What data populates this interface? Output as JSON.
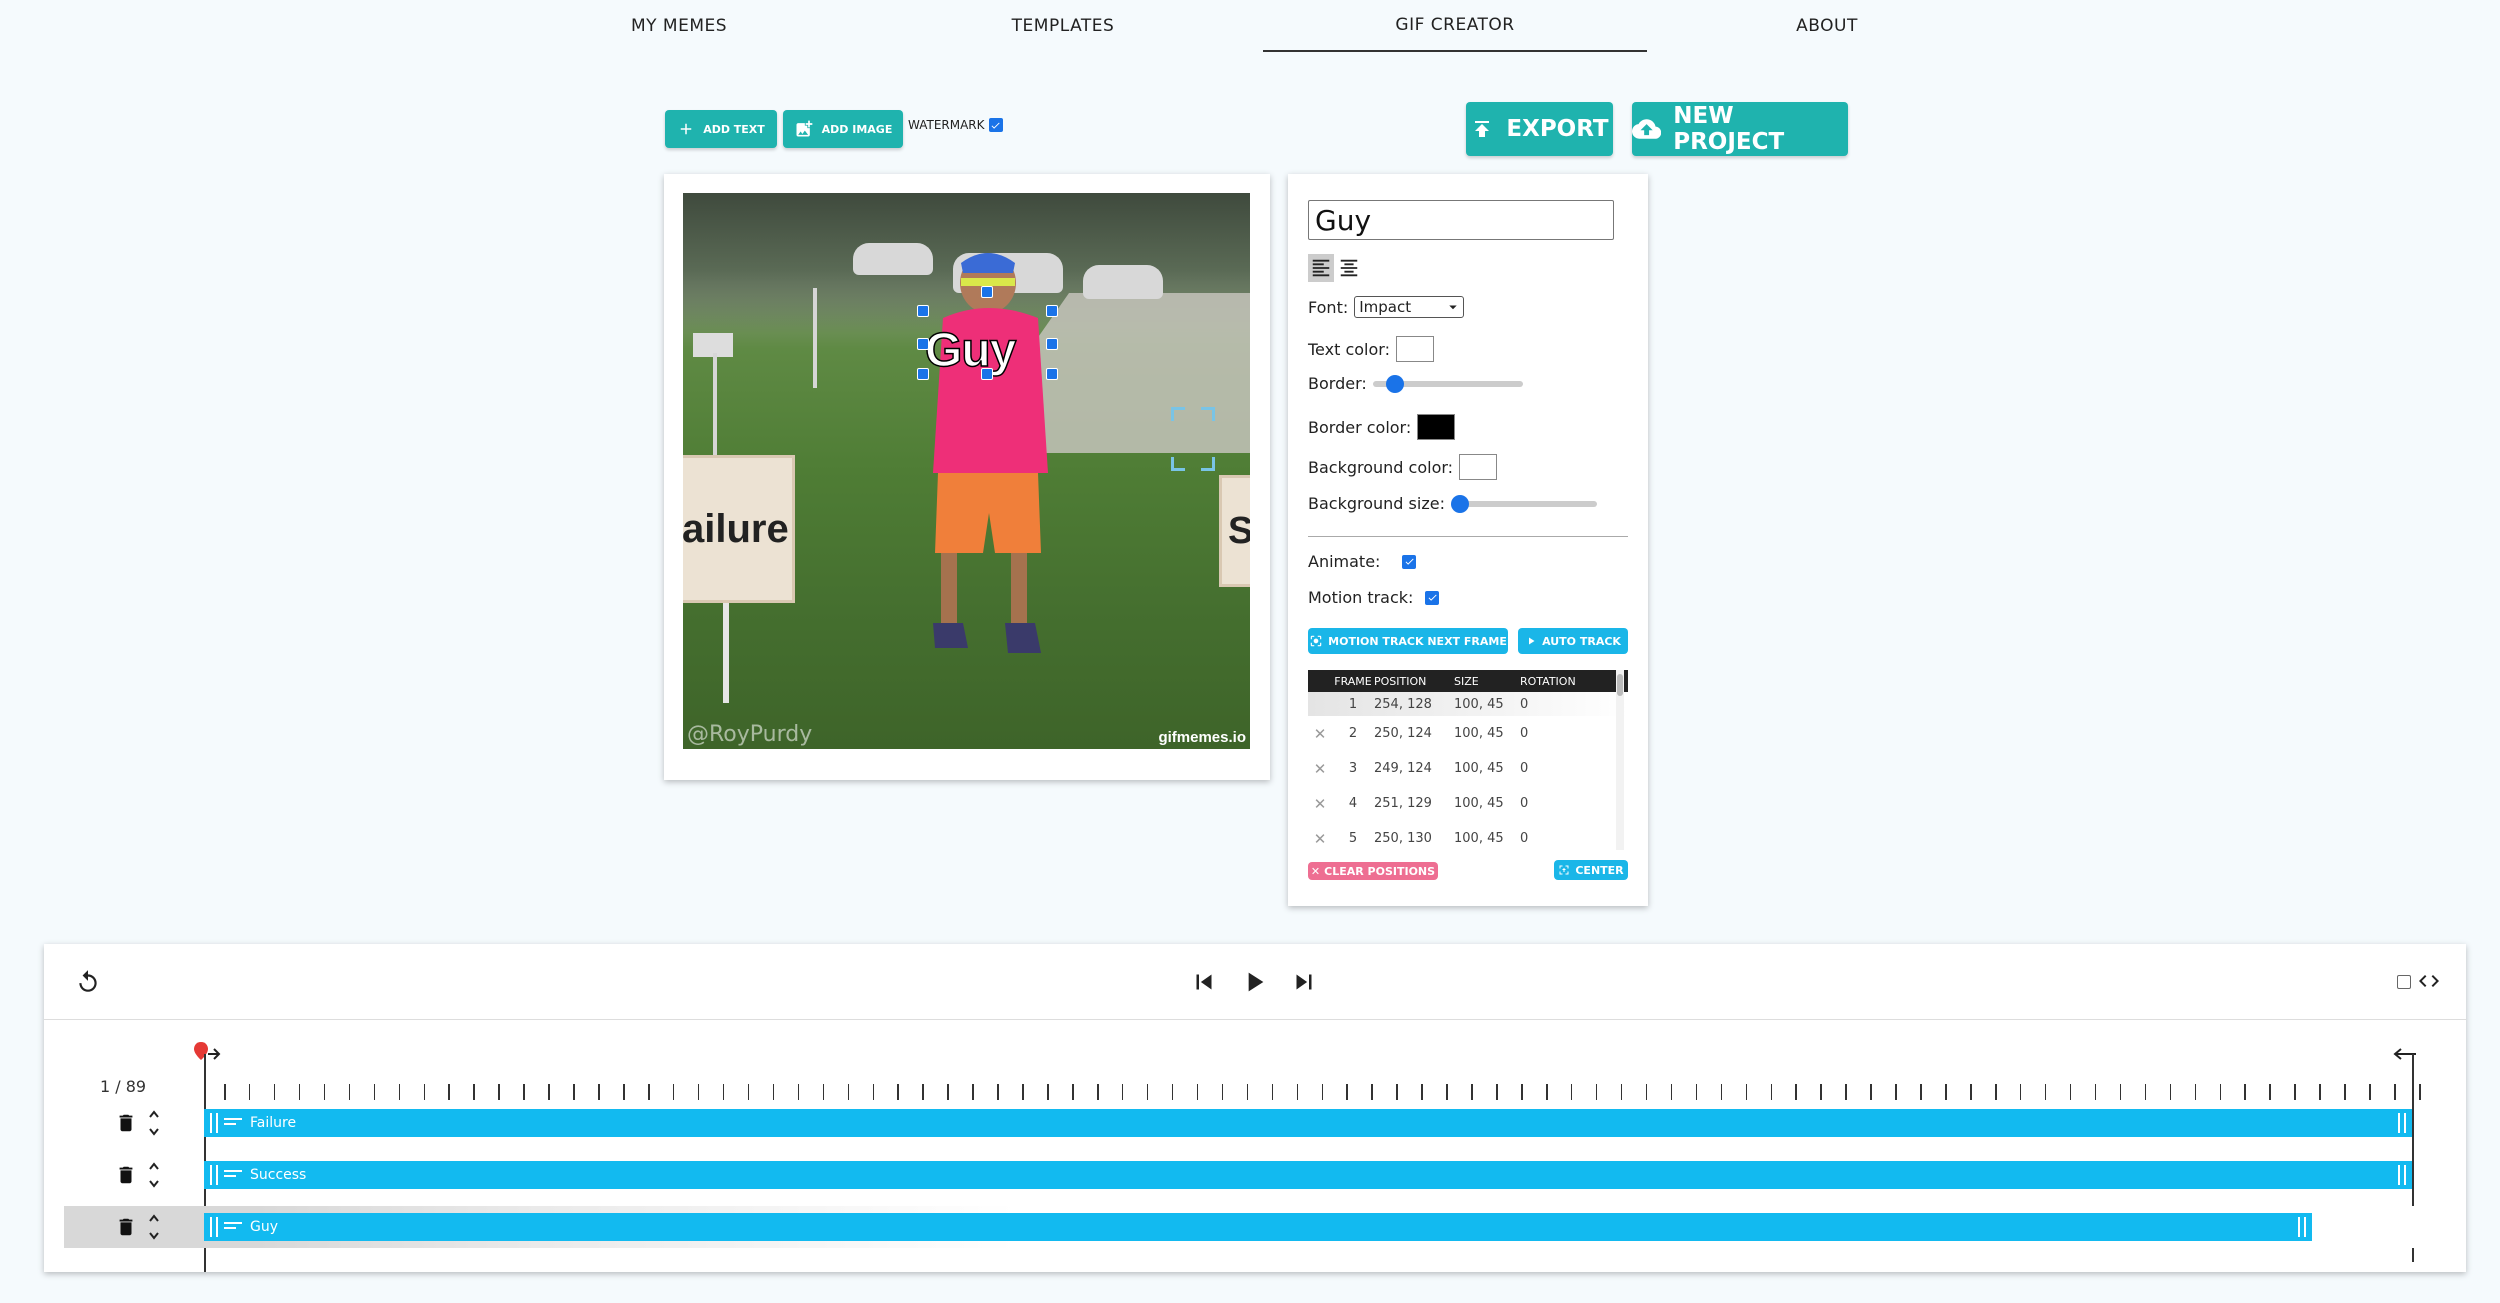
{
  "nav": {
    "tabs": [
      {
        "label": "MY MEMES"
      },
      {
        "label": "TEMPLATES"
      },
      {
        "label": "GIF CREATOR",
        "active": true
      },
      {
        "label": "ABOUT"
      }
    ]
  },
  "toolbar": {
    "add_text": "ADD TEXT",
    "add_image": "ADD IMAGE",
    "watermark": "WATERMARK",
    "watermark_checked": true,
    "export": "EXPORT",
    "new_project": "NEW PROJECT"
  },
  "canvas": {
    "selected_text": "Guy",
    "sign_left": "ailure",
    "sign_right": "S",
    "watermark_left": "@RoyPurdy",
    "watermark_right": "gifmemes.io"
  },
  "props": {
    "text_value": "Guy",
    "font_label": "Font:",
    "font_value": "Impact",
    "text_color_label": "Text color:",
    "text_color": "#ffffff",
    "border_label": "Border:",
    "border_level": 0.1,
    "border_color_label": "Border color:",
    "border_color": "#000000",
    "bg_color_label": "Background color:",
    "bg_color": "#ffffff",
    "bg_size_label": "Background size:",
    "bg_size_level": 0.0,
    "animate_label": "Animate:",
    "animate": true,
    "motion_track_label": "Motion track:",
    "motion_track": true,
    "motion_next_btn": "MOTION TRACK NEXT FRAME",
    "auto_track_btn": "AUTO TRACK",
    "clear_btn": "CLEAR POSITIONS",
    "center_btn": "CENTER",
    "table_headers": [
      "FRAME",
      "POSITION",
      "SIZE",
      "ROTATION"
    ],
    "rows": [
      {
        "frame": "1",
        "position": "254, 128",
        "size": "100, 45",
        "rotation": "0"
      },
      {
        "frame": "2",
        "position": "250, 124",
        "size": "100, 45",
        "rotation": "0"
      },
      {
        "frame": "3",
        "position": "249, 124",
        "size": "100, 45",
        "rotation": "0"
      },
      {
        "frame": "4",
        "position": "251, 129",
        "size": "100, 45",
        "rotation": "0"
      },
      {
        "frame": "5",
        "position": "250, 130",
        "size": "100, 45",
        "rotation": "0"
      }
    ]
  },
  "timeline": {
    "frame_counter": "1 / 89",
    "tracks": [
      {
        "label": "Failure"
      },
      {
        "label": "Success"
      },
      {
        "label": "Guy",
        "selected": true
      }
    ]
  }
}
